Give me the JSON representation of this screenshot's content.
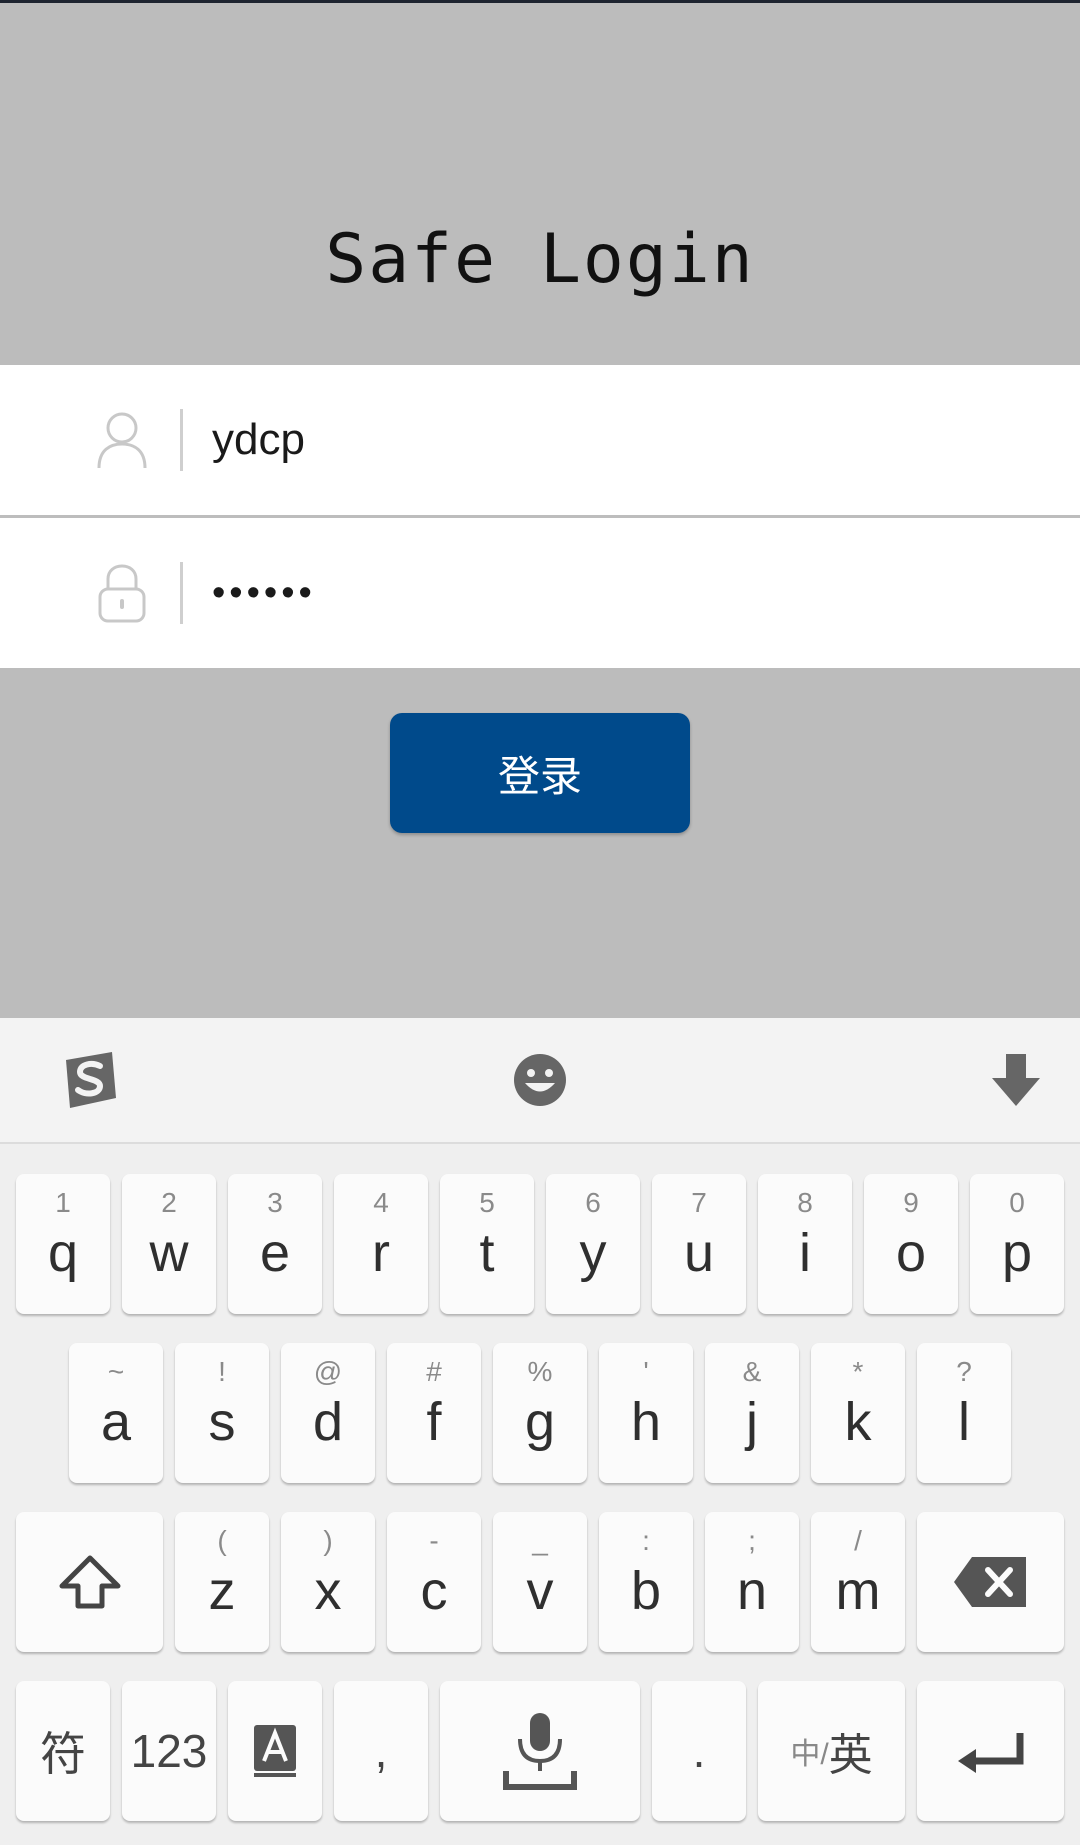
{
  "page": {
    "title": "Safe Login"
  },
  "form": {
    "username": {
      "icon": "user-icon",
      "value": "ydcp"
    },
    "password": {
      "icon": "lock-icon",
      "value": "••••••"
    },
    "login_button": "登录"
  },
  "colors": {
    "background": "#bcbcbc",
    "button": "#004a8b",
    "field": "#ffffff"
  },
  "keyboard": {
    "toolbar": {
      "left_icon": "sogou-logo-icon",
      "center_icon": "emoji-icon",
      "right_icon": "hide-keyboard-icon"
    },
    "row1": [
      {
        "main": "q",
        "hint": "1"
      },
      {
        "main": "w",
        "hint": "2"
      },
      {
        "main": "e",
        "hint": "3"
      },
      {
        "main": "r",
        "hint": "4"
      },
      {
        "main": "t",
        "hint": "5"
      },
      {
        "main": "y",
        "hint": "6"
      },
      {
        "main": "u",
        "hint": "7"
      },
      {
        "main": "i",
        "hint": "8"
      },
      {
        "main": "o",
        "hint": "9"
      },
      {
        "main": "p",
        "hint": "0"
      }
    ],
    "row2": [
      {
        "main": "a",
        "hint": "~"
      },
      {
        "main": "s",
        "hint": "!"
      },
      {
        "main": "d",
        "hint": "@"
      },
      {
        "main": "f",
        "hint": "#"
      },
      {
        "main": "g",
        "hint": "%"
      },
      {
        "main": "h",
        "hint": "'"
      },
      {
        "main": "j",
        "hint": "&"
      },
      {
        "main": "k",
        "hint": "*"
      },
      {
        "main": "l",
        "hint": "?"
      }
    ],
    "row3": [
      {
        "main": "z",
        "hint": "("
      },
      {
        "main": "x",
        "hint": ")"
      },
      {
        "main": "c",
        "hint": "-"
      },
      {
        "main": "v",
        "hint": "_"
      },
      {
        "main": "b",
        "hint": ":"
      },
      {
        "main": "n",
        "hint": ";"
      },
      {
        "main": "m",
        "hint": "/"
      }
    ],
    "row4": {
      "symbol_label": "符",
      "numbers_label": "123",
      "comma_label": ",",
      "period_label": ".",
      "lang_label_small": "中/",
      "lang_label_big": "英"
    }
  }
}
